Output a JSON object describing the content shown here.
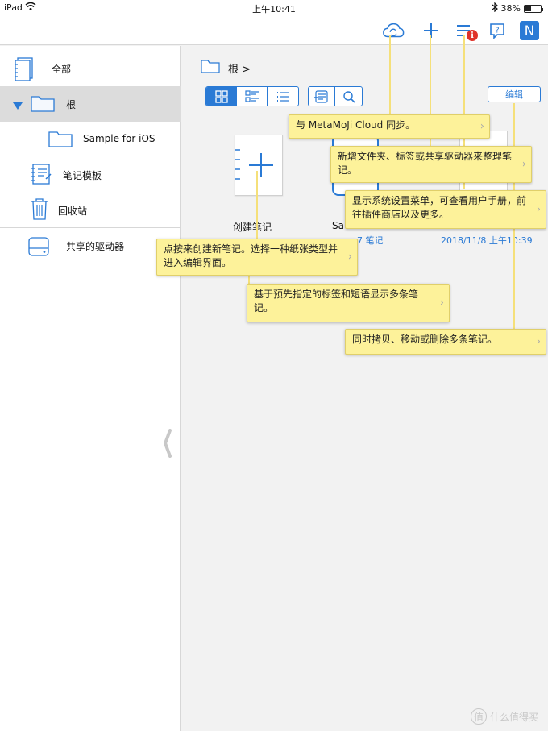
{
  "status": {
    "device": "iPad",
    "time": "上午10:41",
    "battery": "38%",
    "battery_level": 0.38
  },
  "toolbar": {
    "icons": [
      "cloud-sync-icon",
      "plus-icon",
      "menu-icon",
      "help-icon",
      "app-logo-icon"
    ],
    "menu_badge": "i",
    "help_glyph": "?",
    "logo_glyph": "N"
  },
  "sidebar": {
    "items": [
      {
        "label": "全部",
        "icon": "notebooks-icon"
      },
      {
        "label": "根",
        "icon": "folder-icon",
        "selected": true,
        "expanded": true
      },
      {
        "label": "Sample for iOS",
        "icon": "folder-icon"
      },
      {
        "label": "笔记模板",
        "icon": "template-icon"
      },
      {
        "label": "回收站",
        "icon": "trash-icon"
      },
      {
        "label": "共享的驱动器",
        "icon": "drive-icon"
      }
    ]
  },
  "main": {
    "breadcrumb": "根 >",
    "view_modes": [
      "grid-view-icon",
      "detail-view-icon",
      "list-view-icon"
    ],
    "tools": [
      "tag-filter-icon",
      "search-icon"
    ],
    "edit_label": "编辑",
    "create_note_label": "创建笔记",
    "partial_label": "Sa",
    "note_count": "7 笔记",
    "date": "2018/11/8 上午10:39"
  },
  "callouts": [
    "与 MetaMoJi Cloud 同步。",
    "新增文件夹、标签或共享驱动器来整理笔记。",
    "显示系统设置菜单，可查看用户手册，前往插件商店以及更多。",
    "点按来创建新笔记。选择一种纸张类型并进入编辑界面。",
    "基于预先指定的标签和短语显示多条笔记。",
    "同时拷贝、移动或删除多条笔记。"
  ],
  "watermark": {
    "badge": "值",
    "text": "什么值得买"
  },
  "colors": {
    "accent": "#2a7ad5",
    "callout": "#fdf29a",
    "badge": "#e0332a",
    "selected_row": "#dcdcdc"
  }
}
